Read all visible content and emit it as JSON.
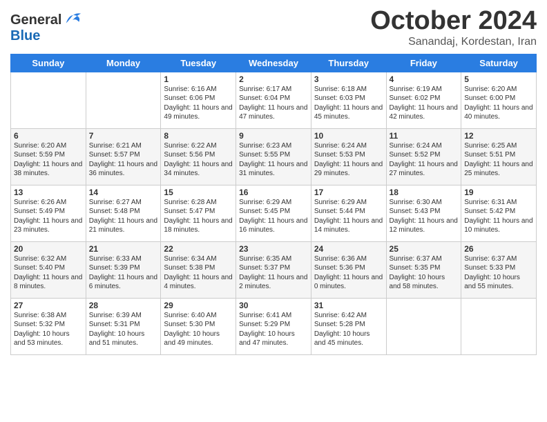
{
  "header": {
    "logo_line1": "General",
    "logo_line2": "Blue",
    "month": "October 2024",
    "location": "Sanandaj, Kordestan, Iran"
  },
  "weekdays": [
    "Sunday",
    "Monday",
    "Tuesday",
    "Wednesday",
    "Thursday",
    "Friday",
    "Saturday"
  ],
  "weeks": [
    [
      {
        "day": "",
        "sunrise": "",
        "sunset": "",
        "daylight": ""
      },
      {
        "day": "",
        "sunrise": "",
        "sunset": "",
        "daylight": ""
      },
      {
        "day": "1",
        "sunrise": "Sunrise: 6:16 AM",
        "sunset": "Sunset: 6:06 PM",
        "daylight": "Daylight: 11 hours and 49 minutes."
      },
      {
        "day": "2",
        "sunrise": "Sunrise: 6:17 AM",
        "sunset": "Sunset: 6:04 PM",
        "daylight": "Daylight: 11 hours and 47 minutes."
      },
      {
        "day": "3",
        "sunrise": "Sunrise: 6:18 AM",
        "sunset": "Sunset: 6:03 PM",
        "daylight": "Daylight: 11 hours and 45 minutes."
      },
      {
        "day": "4",
        "sunrise": "Sunrise: 6:19 AM",
        "sunset": "Sunset: 6:02 PM",
        "daylight": "Daylight: 11 hours and 42 minutes."
      },
      {
        "day": "5",
        "sunrise": "Sunrise: 6:20 AM",
        "sunset": "Sunset: 6:00 PM",
        "daylight": "Daylight: 11 hours and 40 minutes."
      }
    ],
    [
      {
        "day": "6",
        "sunrise": "Sunrise: 6:20 AM",
        "sunset": "Sunset: 5:59 PM",
        "daylight": "Daylight: 11 hours and 38 minutes."
      },
      {
        "day": "7",
        "sunrise": "Sunrise: 6:21 AM",
        "sunset": "Sunset: 5:57 PM",
        "daylight": "Daylight: 11 hours and 36 minutes."
      },
      {
        "day": "8",
        "sunrise": "Sunrise: 6:22 AM",
        "sunset": "Sunset: 5:56 PM",
        "daylight": "Daylight: 11 hours and 34 minutes."
      },
      {
        "day": "9",
        "sunrise": "Sunrise: 6:23 AM",
        "sunset": "Sunset: 5:55 PM",
        "daylight": "Daylight: 11 hours and 31 minutes."
      },
      {
        "day": "10",
        "sunrise": "Sunrise: 6:24 AM",
        "sunset": "Sunset: 5:53 PM",
        "daylight": "Daylight: 11 hours and 29 minutes."
      },
      {
        "day": "11",
        "sunrise": "Sunrise: 6:24 AM",
        "sunset": "Sunset: 5:52 PM",
        "daylight": "Daylight: 11 hours and 27 minutes."
      },
      {
        "day": "12",
        "sunrise": "Sunrise: 6:25 AM",
        "sunset": "Sunset: 5:51 PM",
        "daylight": "Daylight: 11 hours and 25 minutes."
      }
    ],
    [
      {
        "day": "13",
        "sunrise": "Sunrise: 6:26 AM",
        "sunset": "Sunset: 5:49 PM",
        "daylight": "Daylight: 11 hours and 23 minutes."
      },
      {
        "day": "14",
        "sunrise": "Sunrise: 6:27 AM",
        "sunset": "Sunset: 5:48 PM",
        "daylight": "Daylight: 11 hours and 21 minutes."
      },
      {
        "day": "15",
        "sunrise": "Sunrise: 6:28 AM",
        "sunset": "Sunset: 5:47 PM",
        "daylight": "Daylight: 11 hours and 18 minutes."
      },
      {
        "day": "16",
        "sunrise": "Sunrise: 6:29 AM",
        "sunset": "Sunset: 5:45 PM",
        "daylight": "Daylight: 11 hours and 16 minutes."
      },
      {
        "day": "17",
        "sunrise": "Sunrise: 6:29 AM",
        "sunset": "Sunset: 5:44 PM",
        "daylight": "Daylight: 11 hours and 14 minutes."
      },
      {
        "day": "18",
        "sunrise": "Sunrise: 6:30 AM",
        "sunset": "Sunset: 5:43 PM",
        "daylight": "Daylight: 11 hours and 12 minutes."
      },
      {
        "day": "19",
        "sunrise": "Sunrise: 6:31 AM",
        "sunset": "Sunset: 5:42 PM",
        "daylight": "Daylight: 11 hours and 10 minutes."
      }
    ],
    [
      {
        "day": "20",
        "sunrise": "Sunrise: 6:32 AM",
        "sunset": "Sunset: 5:40 PM",
        "daylight": "Daylight: 11 hours and 8 minutes."
      },
      {
        "day": "21",
        "sunrise": "Sunrise: 6:33 AM",
        "sunset": "Sunset: 5:39 PM",
        "daylight": "Daylight: 11 hours and 6 minutes."
      },
      {
        "day": "22",
        "sunrise": "Sunrise: 6:34 AM",
        "sunset": "Sunset: 5:38 PM",
        "daylight": "Daylight: 11 hours and 4 minutes."
      },
      {
        "day": "23",
        "sunrise": "Sunrise: 6:35 AM",
        "sunset": "Sunset: 5:37 PM",
        "daylight": "Daylight: 11 hours and 2 minutes."
      },
      {
        "day": "24",
        "sunrise": "Sunrise: 6:36 AM",
        "sunset": "Sunset: 5:36 PM",
        "daylight": "Daylight: 11 hours and 0 minutes."
      },
      {
        "day": "25",
        "sunrise": "Sunrise: 6:37 AM",
        "sunset": "Sunset: 5:35 PM",
        "daylight": "Daylight: 10 hours and 58 minutes."
      },
      {
        "day": "26",
        "sunrise": "Sunrise: 6:37 AM",
        "sunset": "Sunset: 5:33 PM",
        "daylight": "Daylight: 10 hours and 55 minutes."
      }
    ],
    [
      {
        "day": "27",
        "sunrise": "Sunrise: 6:38 AM",
        "sunset": "Sunset: 5:32 PM",
        "daylight": "Daylight: 10 hours and 53 minutes."
      },
      {
        "day": "28",
        "sunrise": "Sunrise: 6:39 AM",
        "sunset": "Sunset: 5:31 PM",
        "daylight": "Daylight: 10 hours and 51 minutes."
      },
      {
        "day": "29",
        "sunrise": "Sunrise: 6:40 AM",
        "sunset": "Sunset: 5:30 PM",
        "daylight": "Daylight: 10 hours and 49 minutes."
      },
      {
        "day": "30",
        "sunrise": "Sunrise: 6:41 AM",
        "sunset": "Sunset: 5:29 PM",
        "daylight": "Daylight: 10 hours and 47 minutes."
      },
      {
        "day": "31",
        "sunrise": "Sunrise: 6:42 AM",
        "sunset": "Sunset: 5:28 PM",
        "daylight": "Daylight: 10 hours and 45 minutes."
      },
      {
        "day": "",
        "sunrise": "",
        "sunset": "",
        "daylight": ""
      },
      {
        "day": "",
        "sunrise": "",
        "sunset": "",
        "daylight": ""
      }
    ]
  ]
}
